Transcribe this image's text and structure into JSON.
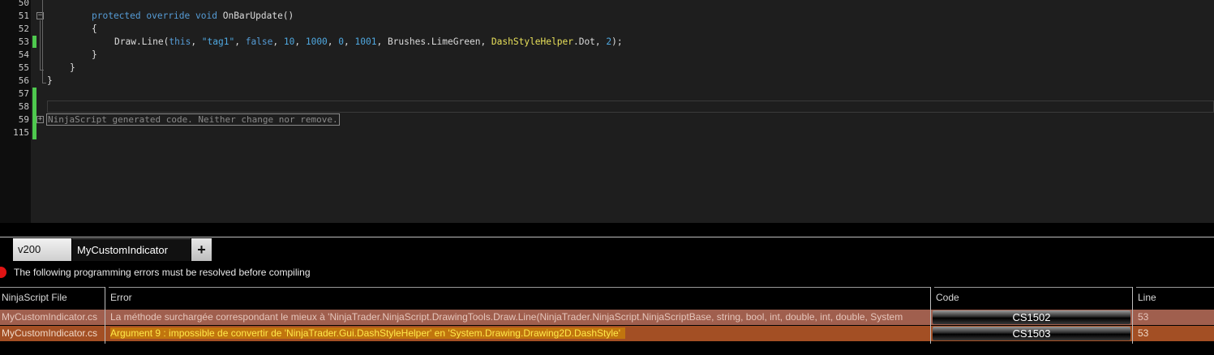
{
  "editor": {
    "line_numbers": [
      "50",
      "51",
      "52",
      "53",
      "54",
      "55",
      "56",
      "57",
      "58",
      "59",
      "115"
    ],
    "code": {
      "l51_kw1": "protected",
      "l51_kw2": "override",
      "l51_kw3": "void",
      "l51_name": "OnBarUpdate()",
      "l52": "{",
      "l53_a": "Draw.Line(",
      "l53_this": "this",
      "l53_sep1": ", ",
      "l53_str": "\"tag1\"",
      "l53_sep2": ", ",
      "l53_false": "false",
      "l53_sep3": ", ",
      "l53_n1": "10",
      "l53_sep4": ", ",
      "l53_n2": "1000",
      "l53_sep5": ", ",
      "l53_n3": "0",
      "l53_sep6": ", ",
      "l53_n4": "1001",
      "l53_mid": ", Brushes.LimeGreen, ",
      "l53_type": "DashStyleHelper",
      "l53_dot": ".Dot, ",
      "l53_n5": "2",
      "l53_end": ");",
      "l54": "}",
      "l55": "}",
      "l56": "}",
      "region": "NinjaScript generated code. Neither change nor remove."
    }
  },
  "tabs": [
    {
      "label": "v200"
    },
    {
      "label": "MyCustomIndicator"
    },
    {
      "label": "+"
    }
  ],
  "errors": {
    "message": "The following programming errors must be resolved before compiling",
    "columns": [
      "NinjaScript File",
      "Error",
      "Code",
      "Line"
    ],
    "rows": [
      {
        "file": "MyCustomIndicator.cs",
        "error": "La méthode surchargée correspondant le mieux à 'NinjaTrader.NinjaScript.DrawingTools.Draw.Line(NinjaTrader.NinjaScript.NinjaScriptBase, string, bool, int, double, int, double, System",
        "code": "CS1502",
        "line": "53"
      },
      {
        "file": "MyCustomIndicator.cs",
        "error": "Argument 9 : impossible de convertir de 'NinjaTrader.Gui.DashStyleHelper' en 'System.Drawing.Drawing2D.DashStyle'",
        "code": "CS1503",
        "line": "53"
      }
    ]
  },
  "colors": {
    "change_marker": "#4ec94e",
    "error_dot": "#e01414",
    "row1_bg": "#a05f4e",
    "row2_bg": "#a34f24",
    "row2_highlight": "#c1750e"
  }
}
